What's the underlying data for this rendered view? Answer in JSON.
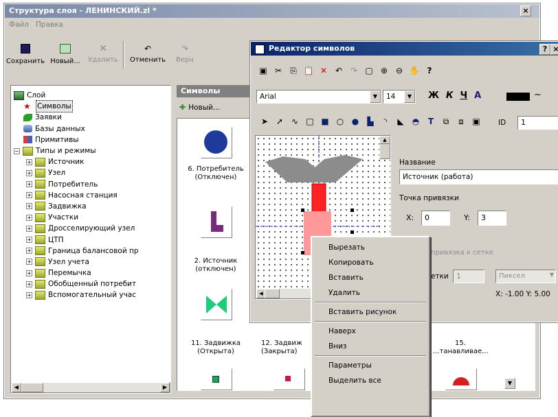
{
  "main_window": {
    "title": "Структура слоя - ЛЕНИНСКИЙ.zl *",
    "menu": [
      "Файл",
      "Правка"
    ],
    "toolbar": {
      "save": "Сохранить",
      "new": "Новый...",
      "delete": "Удалить",
      "undo": "Отменить",
      "redo": "Верн"
    },
    "tree": [
      {
        "label": "Слой",
        "icon": "layer-icon",
        "level": 0
      },
      {
        "label": "Символы",
        "icon": "star-icon",
        "level": 1
      },
      {
        "label": "Заявки",
        "icon": "leaf-icon",
        "level": 1
      },
      {
        "label": "Базы данных",
        "icon": "database-icon",
        "level": 1
      },
      {
        "label": "Примитивы",
        "icon": "primitives-icon",
        "level": 1
      },
      {
        "label": "Типы и режимы",
        "icon": "folder-icon",
        "level": 0
      },
      {
        "label": "Источник",
        "icon": "folder-icon",
        "level": 2
      },
      {
        "label": "Узел",
        "icon": "folder-icon",
        "level": 2
      },
      {
        "label": "Потребитель",
        "icon": "folder-icon",
        "level": 2
      },
      {
        "label": "Насосная станция",
        "icon": "folder-icon",
        "level": 2
      },
      {
        "label": "Задвижка",
        "icon": "folder-icon",
        "level": 2
      },
      {
        "label": "Участки",
        "icon": "pipe-icon",
        "level": 2
      },
      {
        "label": "Дросселирующий узел",
        "icon": "folder-icon",
        "level": 2
      },
      {
        "label": "ЦТП",
        "icon": "folder-icon",
        "level": 2
      },
      {
        "label": "Граница балансовой пр",
        "icon": "folder-icon",
        "level": 2
      },
      {
        "label": "Узел учета",
        "icon": "folder-icon",
        "level": 2
      },
      {
        "label": "Перемычка",
        "icon": "folder-icon",
        "level": 2
      },
      {
        "label": "Обобщенный потребит",
        "icon": "folder-icon",
        "level": 2
      },
      {
        "label": "Вспомогательный учас",
        "icon": "pipe-icon",
        "level": 2
      }
    ],
    "symbols_panel": {
      "header": "Символы",
      "new_button": "Новый...",
      "items": [
        {
          "label": "6. Потребитель (Отключен)"
        },
        {
          "label": "2. Источник (отключен)"
        },
        {
          "label": "11. Задвижка (Открыта)"
        },
        {
          "label": "12. Задвиж (Закрыта)"
        },
        {
          "label": "15. ...танавливае..."
        }
      ]
    }
  },
  "editor_window": {
    "title": "Редактор символов",
    "title_buttons": [
      "?",
      "×"
    ],
    "font_name": "Arial",
    "font_size": "14",
    "format_buttons": [
      "Ж",
      "К",
      "Ч",
      "А"
    ],
    "help_icon": "?",
    "id_label": "ID",
    "id_value": "1",
    "name_label": "Название",
    "name_value": "Источник (работа)",
    "anchor_label": "Точка привязки",
    "x_label": "X:",
    "x_value": "0",
    "y_label": "Y:",
    "y_value": "3",
    "snap_label": "привязка к сетке",
    "grid_step_label": "етки",
    "grid_step_value": "1",
    "grid_unit": "Пиксел",
    "status_coords": "X: -1.00 Y: 5.00",
    "colors": {
      "title": "#0a246a",
      "fill_red": "#ff2222",
      "fill_pink": "#ff9999",
      "gray_shape": "#8c8c8c"
    }
  },
  "context_menu": {
    "items": [
      "Вырезать",
      "Копировать",
      "Вставить",
      "Удалить",
      "Вставить рисунок",
      "Наверх",
      "Вниз",
      "Параметры",
      "Выделить все"
    ]
  }
}
